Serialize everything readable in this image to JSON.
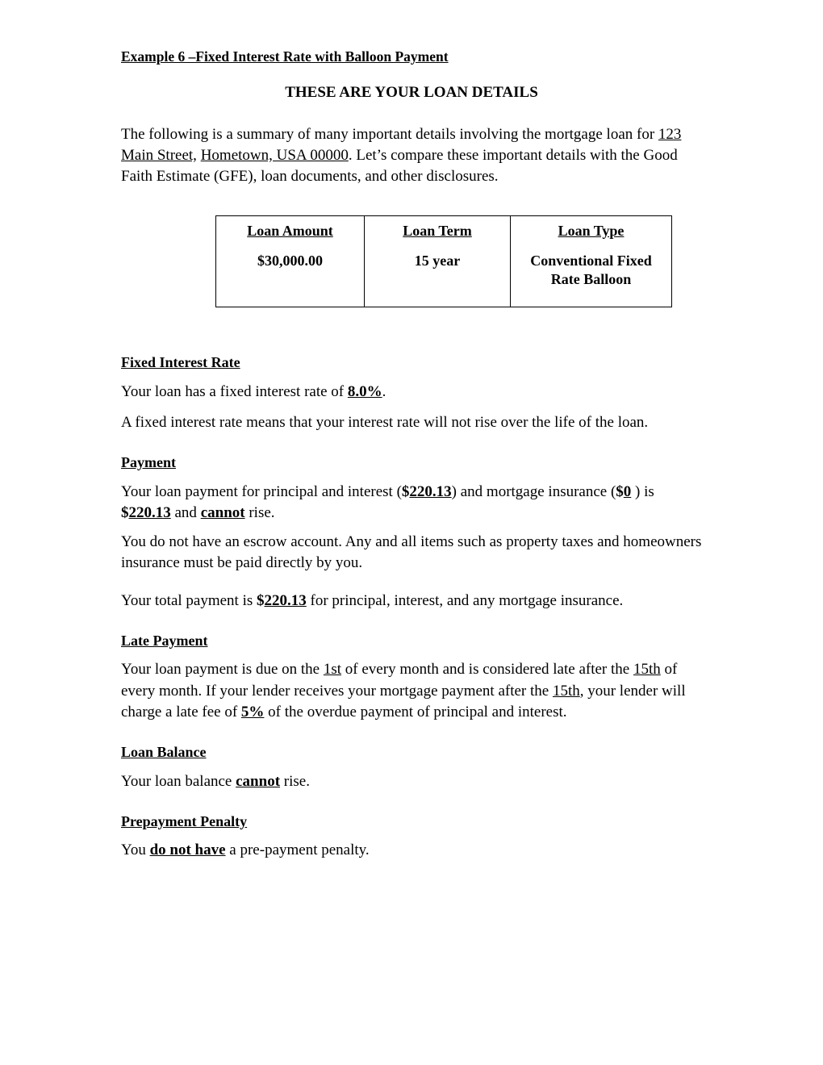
{
  "document": {
    "title_plain": "Example 6 –Fixed Interest Rate with Balloon Payment",
    "title": "Example 6 –Fixed Interest Rate with Balloon Payment",
    "subtitle": "THESE ARE YOUR LOAN DETAILS",
    "intro": {
      "line1": "The following is a summary of many important details involving the mortgage loan for ",
      "address_street": "123 Main Street,",
      "address_space": " ",
      "address_city": "Hometown, USA 00000",
      "line2": ".  Let’s compare these important details with the Good Faith Estimate (GFE), loan documents, and other disclosures."
    }
  },
  "loan_table": {
    "headers": [
      "Loan Amount",
      "Loan Term",
      "Loan Type"
    ],
    "values": [
      "$30,000.00",
      "15 year",
      "Conventional Fixed Rate Balloon"
    ]
  },
  "sections": {
    "fixed_interest_rate": {
      "heading": "Fixed Interest Rate ",
      "para1_before": "Your loan has a fixed interest rate of ",
      "para1_value": "8.0%",
      "para1_after": ".",
      "para2": "A fixed interest rate means that your interest rate will not rise over the life of the loan."
    },
    "payment": {
      "heading": "Payment",
      "para1_a": "Your loan payment for principal and interest (",
      "para1_currency1": "$",
      "para1_amount1": "220.13",
      "para1_b": ") and mortgage insurance (",
      "para1_currency2": "$",
      "para1_amount2": "0",
      "para1_c": " ) is ",
      "para1_currency3": "$",
      "para1_amount3": "220.13",
      "para1_d": " and ",
      "para1_cannot": "cannot",
      "para1_e": " rise.",
      "para2": "You do not have an escrow account. Any and all items such as property taxes and homeowners insurance must be paid directly by you.",
      "para3_a": "Your total payment is ",
      "para3_currency": "$",
      "para3_amount": "220.13",
      "para3_b": " for principal, interest, and any mortgage insurance."
    },
    "late_payment": {
      "heading": "Late Payment",
      "para1_a": "Your loan payment is due on the ",
      "para1_due_day": "1st",
      "para1_b": " of every month and is considered late after the ",
      "para1_late_day": "15th",
      "para1_c": " of every month. If your lender receives your mortgage payment after the ",
      "para1_late_day2": "15th",
      "para1_d": ", your lender will charge a late fee of ",
      "para1_fee": "5%",
      "para1_e": " of the overdue payment of principal and interest."
    },
    "loan_balance": {
      "heading": "Loan Balance",
      "para1_a": "Your loan balance ",
      "para1_cannot": "cannot",
      "para1_b": " rise."
    },
    "prepayment_penalty": {
      "heading": "Prepayment Penalty",
      "para1_a": "You ",
      "para1_emphasis": "do not have",
      "para1_b": " a pre-payment penalty."
    }
  }
}
